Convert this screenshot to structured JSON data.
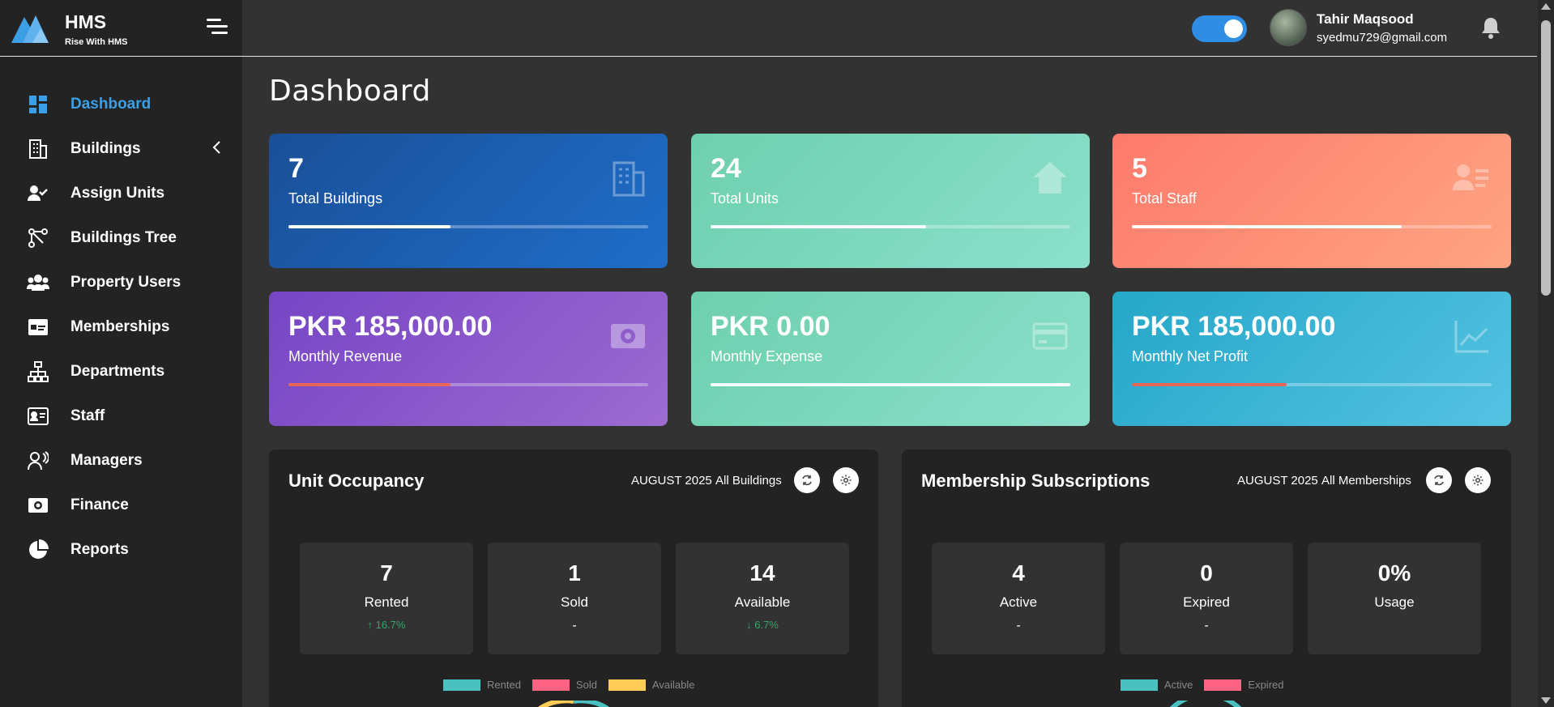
{
  "brand": {
    "title": "HMS",
    "subtitle": "Rise With HMS"
  },
  "sidebar": {
    "items": [
      {
        "label": "Dashboard",
        "icon": "dashboard-icon",
        "active": true
      },
      {
        "label": "Buildings",
        "icon": "building-icon",
        "has_submenu": true
      },
      {
        "label": "Assign Units",
        "icon": "user-check-icon"
      },
      {
        "label": "Buildings Tree",
        "icon": "tree-icon"
      },
      {
        "label": "Property Users",
        "icon": "users-icon"
      },
      {
        "label": "Memberships",
        "icon": "id-card-icon"
      },
      {
        "label": "Departments",
        "icon": "sitemap-icon"
      },
      {
        "label": "Staff",
        "icon": "badge-icon"
      },
      {
        "label": "Managers",
        "icon": "manager-icon"
      },
      {
        "label": "Finance",
        "icon": "money-icon"
      },
      {
        "label": "Reports",
        "icon": "pie-chart-icon"
      }
    ]
  },
  "topbar": {
    "user_name": "Tahir Maqsood",
    "user_email": "syedmu729@gmail.com",
    "theme_toggle_on": true
  },
  "main": {
    "page_title": "Dashboard",
    "cards": [
      {
        "value": "7",
        "caption": "Total Buildings",
        "progress": 0.45,
        "icon": "building-icon"
      },
      {
        "value": "24",
        "caption": "Total Units",
        "progress": 0.6,
        "icon": "home-icon"
      },
      {
        "value": "5",
        "caption": "Total Staff",
        "progress": 0.75,
        "icon": "staff-list-icon"
      },
      {
        "value": "PKR 185,000.00",
        "caption": "Monthly Revenue",
        "progress": 0.45,
        "icon": "money-icon"
      },
      {
        "value": "PKR 0.00",
        "caption": "Monthly Expense",
        "progress": 1.0,
        "icon": "credit-card-icon"
      },
      {
        "value": "PKR 185,000.00",
        "caption": "Monthly Net Profit",
        "progress": 0.43,
        "icon": "line-chart-icon"
      }
    ],
    "occupancy": {
      "title": "Unit Occupancy",
      "month": "AUGUST 2025",
      "filter": "All Buildings",
      "stats": [
        {
          "num": "7",
          "label": "Rented",
          "change": "↑ 16.7%"
        },
        {
          "num": "1",
          "label": "Sold",
          "change": "-"
        },
        {
          "num": "14",
          "label": "Available",
          "change": "↓ 6.7%"
        }
      ],
      "legend": [
        "Rented",
        "Sold",
        "Available"
      ]
    },
    "memberships": {
      "title": "Membership Subscriptions",
      "month": "AUGUST 2025",
      "filter": "All Memberships",
      "stats": [
        {
          "num": "4",
          "label": "Active",
          "change": "-"
        },
        {
          "num": "0",
          "label": "Expired",
          "change": "-"
        },
        {
          "num": "0%",
          "label": "Usage",
          "change": ""
        }
      ],
      "legend": [
        "Active",
        "Expired"
      ]
    }
  },
  "colors": {
    "accent": "#3b9fe8",
    "rented": "#4bc0c0",
    "sold": "#ff6384",
    "available": "#ffcd56",
    "active": "#4bc0c0",
    "expired": "#ff6384"
  }
}
